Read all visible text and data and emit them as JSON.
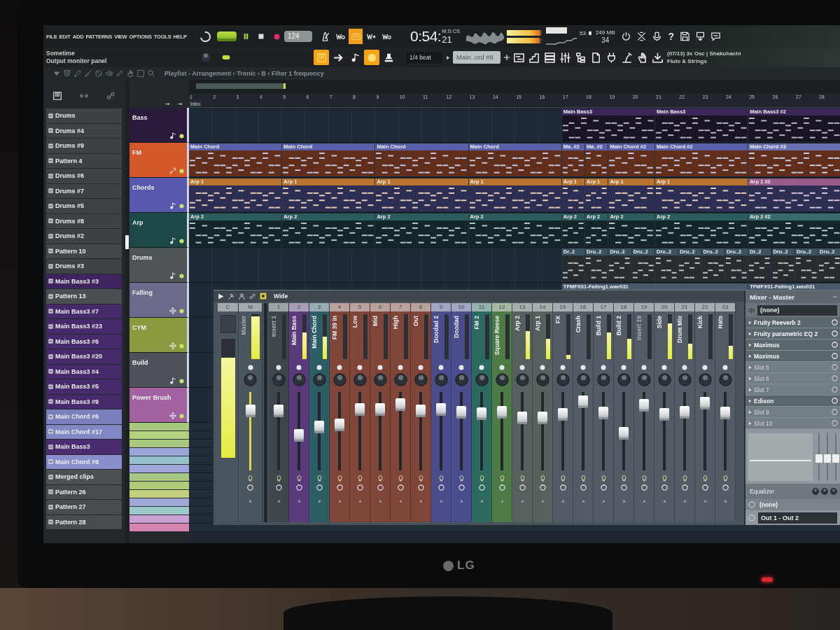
{
  "monitor": {
    "brand": "LG"
  },
  "menu": [
    "FILE",
    "EDIT",
    "ADD",
    "PATTERNS",
    "VIEW",
    "OPTIONS",
    "TOOLS",
    "HELP"
  ],
  "toolbar": {
    "mode_switch": {
      "on": true
    },
    "tempo": "124",
    "toggles": [
      {
        "on": false
      },
      {
        "on": false
      },
      {
        "on": true
      },
      {
        "on": false
      },
      {
        "on": false
      }
    ],
    "time": {
      "value": "0:54:",
      "fraction": "21",
      "format": "M:S:CS"
    },
    "output_meter": [
      {
        "level": 0.96
      },
      {
        "level": 0.93
      }
    ],
    "cpu": "53",
    "memory": "249 MB",
    "polyphony": "34",
    "help": "?"
  },
  "hint_bar": {
    "title": "Sometime",
    "text": "Output monitor panel"
  },
  "toolbar2": {
    "toggles": [
      {
        "on": true
      },
      {
        "on": false
      },
      {
        "on": false
      },
      {
        "on": true
      },
      {
        "on": false
      }
    ],
    "snap": "1/4 beat",
    "pattern": "Main..ord #8",
    "hint": "(07/13) 3x Osc | Shakuhachi",
    "hint_sub": "Flute & Strings"
  },
  "browser": {
    "items": [
      {
        "label": "Drums",
        "color": "#3d4245"
      },
      {
        "label": "Drums #4",
        "color": "#3d4245"
      },
      {
        "label": "Drums #9",
        "color": "#3d4245"
      },
      {
        "label": "Pattern 4",
        "color": "#3d4245"
      },
      {
        "label": "Drums #6",
        "color": "#3d4245"
      },
      {
        "label": "Drums #7",
        "color": "#3d4245"
      },
      {
        "label": "Drums #5",
        "color": "#3d4245"
      },
      {
        "label": "Drums #8",
        "color": "#3d4245"
      },
      {
        "label": "Drums #2",
        "color": "#3d4245"
      },
      {
        "label": "Pattern 10",
        "color": "#42474a"
      },
      {
        "label": "Drums #3",
        "color": "#3d4245"
      },
      {
        "label": "Main Bass3 #3",
        "color": "#3f2460"
      },
      {
        "label": "Pattern 13",
        "color": "#4a4f52"
      },
      {
        "label": "Main Bass3 #7",
        "color": "#472a6c"
      },
      {
        "label": "Main Bass3 #23",
        "color": "#472a6c"
      },
      {
        "label": "Main Bass3 #6",
        "color": "#472a6c"
      },
      {
        "label": "Main Bass3 #20",
        "color": "#472a6c"
      },
      {
        "label": "Main Bass3 #4",
        "color": "#472a6c"
      },
      {
        "label": "Main Bass3 #5",
        "color": "#472a6c"
      },
      {
        "label": "Main Bass3 #9",
        "color": "#472a6c"
      },
      {
        "label": "Main Chord #6",
        "color": "#7a80bc"
      },
      {
        "label": "Main Chord #17",
        "color": "#8087c4"
      },
      {
        "label": "Main Bass3",
        "color": "#4b2c70"
      },
      {
        "label": "Main Chord #8",
        "color": "#878ecb"
      },
      {
        "label": "Merged clips",
        "color": "#4a5054"
      },
      {
        "label": "Pattern 26",
        "color": "#464c50"
      },
      {
        "label": "Pattern 27",
        "color": "#464c50"
      },
      {
        "label": "Pattern 28",
        "color": "#464c50"
      }
    ]
  },
  "playlist": {
    "path": "Playlist - Arrangement › Tronic › B › Filter 1 frequency",
    "marker": "Intro",
    "bars": [
      "1",
      "2",
      "3",
      "4",
      "5",
      "6",
      "7",
      "8",
      "9",
      "10",
      "11",
      "12",
      "13",
      "14",
      "15",
      "16",
      "17",
      "18",
      "19",
      "20",
      "21",
      "22",
      "23",
      "24",
      "25",
      "26",
      "27",
      "28"
    ],
    "tracks": [
      {
        "name": "Bass",
        "kind": "pattern",
        "color": "#2a1a3c",
        "clips": [
          {
            "kind": "rest"
          },
          {
            "kind": "rest"
          },
          {
            "kind": "rest"
          },
          {
            "kind": "rest"
          },
          {
            "kind": "phrase",
            "label": "Main Bass3",
            "color": "#3a2858"
          },
          {
            "kind": "phrase",
            "label": "Main Bass3",
            "color": "#3a2858"
          },
          {
            "kind": "phrase",
            "label": "Main Bass3 #2",
            "color": "#3a2858"
          }
        ]
      },
      {
        "name": "FM",
        "kind": "plugin",
        "color": "#d4582a",
        "clips": [
          {
            "kind": "phrase",
            "label": "Main Chord",
            "color": "#5a60a8"
          },
          {
            "kind": "phrase",
            "label": "Main Chord",
            "color": "#5a60a8"
          },
          {
            "kind": "phrase",
            "label": "Main Chord",
            "color": "#5a60a8"
          },
          {
            "kind": "phrase",
            "label": "Main Chord",
            "color": "#5a60a8"
          },
          {
            "kind": "bar",
            "label": "Ma..#2",
            "color": "#5a60a8"
          },
          {
            "kind": "bar",
            "label": "Ma..#2",
            "color": "#5a60a8"
          },
          {
            "kind": "pair",
            "label": "Main Chord #2",
            "color": "#5a60a8"
          },
          {
            "kind": "phrase",
            "label": "Main Chord #2",
            "color": "#5a60a8"
          },
          {
            "kind": "phrase",
            "label": "Main Chord #3",
            "color": "#6a70b0"
          }
        ]
      },
      {
        "name": "Chords",
        "kind": "pattern",
        "color": "#5858ae",
        "clips": [
          {
            "kind": "phrase",
            "label": "Arp 1",
            "color": "#b8742e"
          },
          {
            "kind": "phrase",
            "label": "Arp 1",
            "color": "#b8742e"
          },
          {
            "kind": "phrase",
            "label": "Arp 1",
            "color": "#b8742e"
          },
          {
            "kind": "phrase",
            "label": "Arp 1",
            "color": "#b8742e"
          },
          {
            "kind": "bar",
            "label": "Arp 1",
            "color": "#b8742e"
          },
          {
            "kind": "bar",
            "label": "Arp 1",
            "color": "#b8742e"
          },
          {
            "kind": "pair",
            "label": "Arp 1",
            "color": "#b8742e"
          },
          {
            "kind": "phrase",
            "label": "Arp 1",
            "color": "#b8742e"
          },
          {
            "kind": "phrase",
            "label": "Arp 1 #2",
            "color": "#9a5a8a"
          }
        ]
      },
      {
        "name": "Arp",
        "kind": "pattern",
        "color": "#1c4846",
        "clips": [
          {
            "kind": "phrase",
            "label": "Arp 2",
            "color": "#2c5c5e"
          },
          {
            "kind": "phrase",
            "label": "Arp 2",
            "color": "#2c5c5e"
          },
          {
            "kind": "phrase",
            "label": "Arp 2",
            "color": "#2c5c5e"
          },
          {
            "kind": "phrase",
            "label": "Arp 2",
            "color": "#2c5c5e"
          },
          {
            "kind": "bar",
            "label": "Arp 2",
            "color": "#2c5c5e"
          },
          {
            "kind": "bar",
            "label": "Arp 2",
            "color": "#2c5c5e"
          },
          {
            "kind": "pair",
            "label": "Arp 2",
            "color": "#2c5c5e"
          },
          {
            "kind": "phrase",
            "label": "Arp 2",
            "color": "#2c5c5e"
          },
          {
            "kind": "phrase",
            "label": "Arp 2 #2",
            "color": "#3a6a6c"
          }
        ]
      },
      {
        "name": "Drums",
        "kind": "pattern",
        "color": "#4e5458",
        "clips": [
          {
            "kind": "rest"
          },
          {
            "kind": "rest"
          },
          {
            "kind": "rest"
          },
          {
            "kind": "rest"
          },
          {
            "kind": "bar",
            "label": "Dr..2",
            "color": "#3c5462"
          },
          {
            "kind": "bar",
            "label": "Dru..2",
            "color": "#3c5462"
          },
          {
            "kind": "bar",
            "label": "Dru..2",
            "color": "#3c5462"
          },
          {
            "kind": "bar",
            "label": "Dru..2",
            "color": "#3c5462"
          },
          {
            "kind": "bar",
            "label": "Dru..2",
            "color": "#3c5462"
          },
          {
            "kind": "bar",
            "label": "Dru..2",
            "color": "#3c5462"
          },
          {
            "kind": "bar",
            "label": "Dru..2",
            "color": "#3c5462"
          },
          {
            "kind": "bar",
            "label": "Dru..2",
            "color": "#3c5462"
          },
          {
            "kind": "bar",
            "label": "Dr..2",
            "color": "#3c5462"
          },
          {
            "kind": "bar",
            "label": "Dru..2",
            "color": "#3c5462"
          },
          {
            "kind": "bar",
            "label": "Dru..2",
            "color": "#3c5462"
          },
          {
            "kind": "bar",
            "label": "Dru..2",
            "color": "#3c5462"
          }
        ]
      },
      {
        "name": "Falling",
        "kind": "audio",
        "color": "#6a6a8a",
        "clips": [
          {
            "kind": "rest"
          },
          {
            "kind": "rest"
          },
          {
            "kind": "rest"
          },
          {
            "kind": "rest"
          },
          {
            "kind": "section",
            "label": "TFMFX01-Falling1.wav031",
            "color": "#4a5a6c"
          },
          {
            "kind": "phrase",
            "label": "TFMFX01-Falling1.wav031",
            "color": "#4a5a6c"
          }
        ]
      },
      {
        "name": "CYM",
        "kind": "audio",
        "color": "#8a9a40"
      },
      {
        "name": "Build",
        "kind": "pattern",
        "color": "#4e535a"
      },
      {
        "name": "Power Brush",
        "kind": "audio",
        "color": "#a262a2"
      }
    ],
    "automation_tracks": [
      {
        "color": "#a8c87e"
      },
      {
        "color": "#b4d27e"
      },
      {
        "color": "#a8c87e"
      },
      {
        "color": "#9aa6d8"
      },
      {
        "color": "#96c0cc"
      },
      {
        "color": "#a0a6dc"
      },
      {
        "color": "#a6c684"
      },
      {
        "color": "#b0cc7a"
      },
      {
        "color": "#c2d07c"
      },
      {
        "color": "#a0a8d8"
      },
      {
        "color": "#9ccac8"
      },
      {
        "color": "#c8a0d4"
      },
      {
        "color": "#d684b2"
      }
    ]
  },
  "mixer": {
    "layout": "Wide",
    "strips": [
      {
        "number": "C",
        "kind": "current",
        "color": "#4b555d",
        "meter": {
          "level": 0.84
        }
      },
      {
        "number": "M",
        "kind": "master",
        "name": "Master",
        "color": "#4b555d",
        "in_use": false,
        "meter": {
          "level": 0.95
        },
        "fader": {
          "level": 0.81
        }
      },
      {
        "number": "1",
        "kind": "insert",
        "name": "Insert 1",
        "color": "#3e464b",
        "in_use": false,
        "meter": {
          "level": 0
        },
        "fader": {
          "level": 0.81
        }
      },
      {
        "number": "2",
        "kind": "insert",
        "name": "Main Bass",
        "color": "#5b3a7c",
        "in_use": true,
        "meter": {
          "level": 0.6
        },
        "fader": {
          "level": 0.44
        }
      },
      {
        "number": "3",
        "kind": "insert",
        "name": "Main Chord",
        "color": "#2d5e66",
        "in_use": true,
        "meter": {
          "level": 0.5
        },
        "fader": {
          "level": 0.56
        }
      },
      {
        "number": "4",
        "kind": "insert",
        "name": "FM 39 in",
        "color": "#7e4538",
        "in_use": true,
        "meter": {
          "level": 0
        },
        "fader": {
          "level": 0.6
        }
      },
      {
        "number": "5",
        "kind": "insert",
        "name": "Low",
        "color": "#7e4538",
        "in_use": true,
        "meter": {
          "level": 0
        },
        "fader": {
          "level": 0.83
        }
      },
      {
        "number": "6",
        "kind": "insert",
        "name": "Mid",
        "color": "#7e4538",
        "in_use": true,
        "meter": {
          "level": 0
        },
        "fader": {
          "level": 0.83
        }
      },
      {
        "number": "7",
        "kind": "insert",
        "name": "High",
        "color": "#7e4538",
        "in_use": true,
        "meter": {
          "level": 0
        },
        "fader": {
          "level": 0.9
        }
      },
      {
        "number": "8",
        "kind": "insert",
        "name": "Out",
        "color": "#7e4538",
        "in_use": true,
        "meter": {
          "level": 0
        },
        "fader": {
          "level": 0.81
        }
      },
      {
        "number": "9",
        "kind": "insert",
        "name": "Doodad 2",
        "color": "#4a4c8c",
        "in_use": true,
        "meter": {
          "level": 0
        },
        "fader": {
          "level": 0.83
        }
      },
      {
        "number": "10",
        "kind": "insert",
        "name": "Doodad",
        "color": "#4a4c8c",
        "in_use": true,
        "meter": {
          "level": 0
        },
        "fader": {
          "level": 0.79
        }
      },
      {
        "number": "11",
        "kind": "insert",
        "name": "FM 2",
        "color": "#2b6a5c",
        "in_use": true,
        "meter": {
          "level": 0
        },
        "fader": {
          "level": 0.77
        }
      },
      {
        "number": "12",
        "kind": "insert",
        "name": "Square Reese",
        "color": "#4e7a46",
        "in_use": true,
        "meter": {
          "level": 0
        },
        "fader": {
          "level": 0.79
        }
      },
      {
        "number": "13",
        "kind": "insert",
        "name": "Arp 2",
        "color": "#56605f",
        "in_use": true,
        "meter": {
          "level": 0.62
        },
        "fader": {
          "level": 0.7
        }
      },
      {
        "number": "14",
        "kind": "insert",
        "name": "Arp 1",
        "color": "#56605f",
        "in_use": true,
        "meter": {
          "level": 0.45
        },
        "fader": {
          "level": 0.7
        }
      },
      {
        "number": "15",
        "kind": "insert",
        "name": "FX",
        "color": "#535c64",
        "in_use": true,
        "meter": {
          "level": 0.1
        },
        "fader": {
          "level": 0.76
        }
      },
      {
        "number": "16",
        "kind": "insert",
        "name": "Crash",
        "color": "#535c64",
        "in_use": true,
        "meter": {
          "level": 0
        },
        "fader": {
          "level": 0.95
        }
      },
      {
        "number": "17",
        "kind": "insert",
        "name": "Build 1",
        "color": "#535c64",
        "in_use": true,
        "meter": {
          "level": 0.6
        },
        "fader": {
          "level": 0.78
        }
      },
      {
        "number": "18",
        "kind": "insert",
        "name": "Build 2",
        "color": "#535c64",
        "in_use": true,
        "meter": {
          "level": 0.45
        },
        "fader": {
          "level": 0.47
        }
      },
      {
        "number": "19",
        "kind": "insert",
        "name": "Insert 19",
        "color": "#535c64",
        "in_use": false,
        "meter": {
          "level": 0
        },
        "fader": {
          "level": 0.89
        }
      },
      {
        "number": "20",
        "kind": "insert",
        "name": "Side",
        "color": "#535c64",
        "in_use": true,
        "meter": {
          "level": 0.8
        },
        "fader": {
          "level": 0.76
        }
      },
      {
        "number": "21",
        "kind": "insert",
        "name": "Drum Mix",
        "color": "#535c64",
        "in_use": true,
        "meter": {
          "level": 0.35
        },
        "fader": {
          "level": 0.79
        }
      },
      {
        "number": "22",
        "kind": "insert",
        "name": "Kick",
        "color": "#535c64",
        "in_use": true,
        "meter": {
          "level": 0
        },
        "fader": {
          "level": 0.93
        }
      },
      {
        "number": "23",
        "kind": "insert",
        "name": "Hats",
        "color": "#535c64",
        "in_use": true,
        "meter": {
          "level": 0.3
        },
        "fader": {
          "level": 0.78
        }
      }
    ],
    "master": {
      "title": "Mixer - Master",
      "input": "(none)",
      "slots": [
        {
          "name": "Fruity Reeverb 2",
          "empty": false
        },
        {
          "name": "Fruity parametric EQ 2",
          "empty": false
        },
        {
          "name": "Maximus",
          "empty": false
        },
        {
          "name": "Maximus",
          "empty": false
        },
        {
          "name": "Slot 5",
          "empty": true
        },
        {
          "name": "Slot 6",
          "empty": true
        },
        {
          "name": "Slot 7",
          "empty": true
        },
        {
          "name": "Edison",
          "empty": false
        },
        {
          "name": "Slot 9",
          "empty": true
        },
        {
          "name": "Slot 10",
          "empty": true
        }
      ],
      "eq_label": "Equalizer",
      "send": "(none)",
      "output": "Out 1 - Out 2"
    }
  }
}
